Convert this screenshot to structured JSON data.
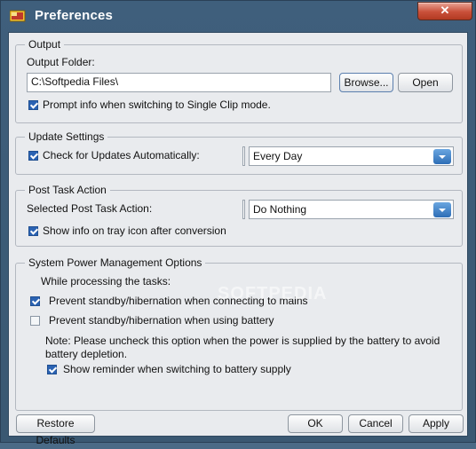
{
  "window": {
    "title": "Preferences",
    "close_label": "✕"
  },
  "output": {
    "legend": "Output",
    "folder_label": "Output Folder:",
    "folder_value": "C:\\Softpedia Files\\",
    "browse_label": "Browse...",
    "open_label": "Open",
    "prompt_label": "Prompt info when switching to Single Clip mode.",
    "prompt_checked": true
  },
  "update": {
    "legend": "Update Settings",
    "check_label": "Check for Updates Automatically:",
    "check_checked": true,
    "frequency_value": "Every Day"
  },
  "post_task": {
    "legend": "Post Task Action",
    "selected_label": "Selected Post Task Action:",
    "action_value": "Do Nothing",
    "tray_label": "Show info on tray icon after conversion",
    "tray_checked": true
  },
  "power": {
    "legend": "System Power Management Options",
    "while_label": "While processing the tasks:",
    "mains_label": "Prevent standby/hibernation when connecting to mains",
    "mains_checked": true,
    "battery_label": "Prevent standby/hibernation when using battery",
    "battery_checked": false,
    "note_line1": "Note: Please uncheck this option when the power is supplied by the battery to avoid",
    "note_line2": "battery depletion.",
    "reminder_label": "Show reminder when switching to battery supply",
    "reminder_checked": true
  },
  "footer": {
    "restore_label": "Restore Defaults",
    "ok_label": "OK",
    "cancel_label": "Cancel",
    "apply_label": "Apply"
  },
  "watermark": "SOFTPEDIA",
  "colors": {
    "accent": "#2b63b3",
    "titlebar": "#3f5f7c",
    "close": "#c9503a"
  }
}
